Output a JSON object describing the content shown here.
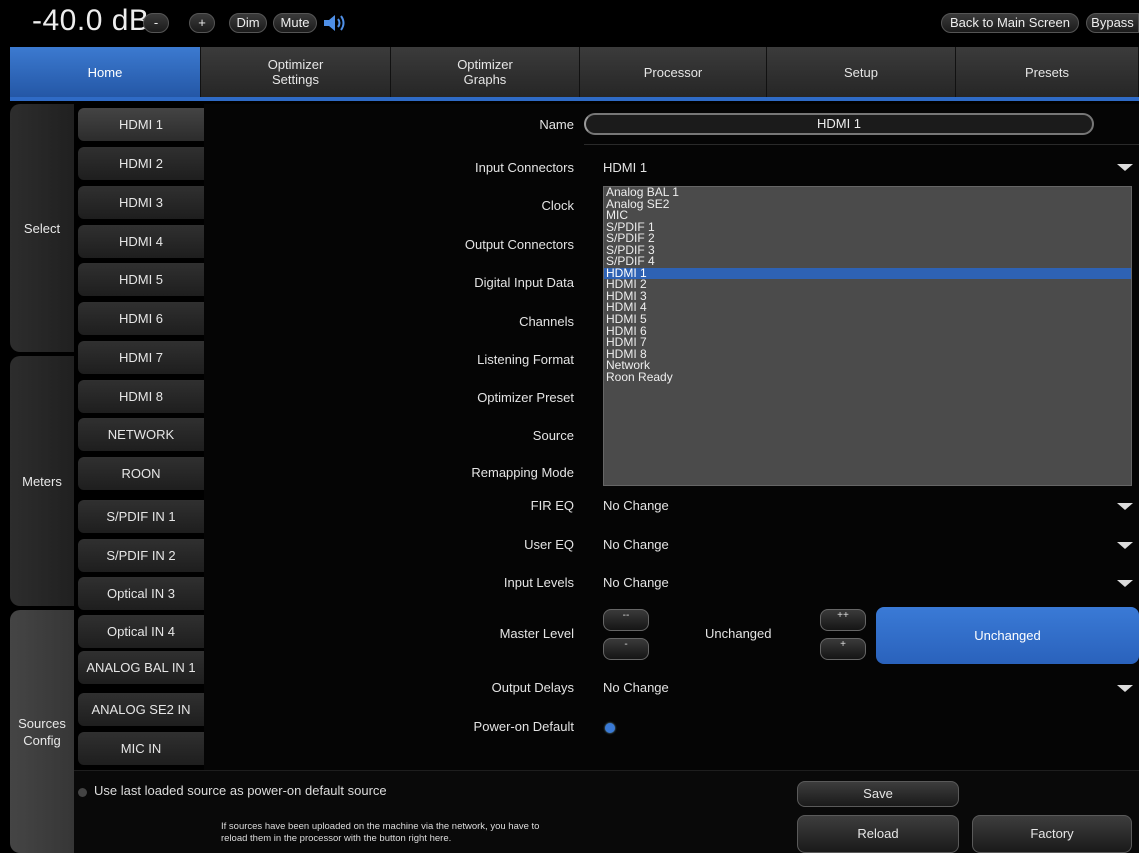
{
  "topbar": {
    "volume": "-40.0 dB",
    "minus": "-",
    "plus": "+",
    "dim": "Dim",
    "mute": "Mute",
    "back": "Back to Main Screen",
    "bypass": "Bypass"
  },
  "tabs": [
    {
      "label": "Home"
    },
    {
      "label": "Optimizer\nSettings"
    },
    {
      "label": "Optimizer\nGraphs"
    },
    {
      "label": "Processor"
    },
    {
      "label": "Setup"
    },
    {
      "label": "Presets"
    }
  ],
  "side": {
    "select": "Select",
    "meters": "Meters",
    "sources": "Sources\nConfig"
  },
  "sources": [
    "HDMI 1",
    "HDMI 2",
    "HDMI 3",
    "HDMI 4",
    "HDMI 5",
    "HDMI 6",
    "HDMI 7",
    "HDMI 8",
    "NETWORK",
    "ROON",
    "S/PDIF IN 1",
    "S/PDIF IN 2",
    "Optical IN 3",
    "Optical IN 4",
    "ANALOG BAL IN 1",
    "ANALOG SE2 IN",
    "MIC IN"
  ],
  "form": {
    "name_label": "Name",
    "name_value": "HDMI 1",
    "input_connectors_label": "Input Connectors",
    "input_connectors_value": "HDMI 1",
    "clock_label": "Clock",
    "output_connectors_label": "Output Connectors",
    "digital_input_label": "Digital Input Data",
    "channels_label": "Channels",
    "listening_format_label": "Listening Format",
    "optimizer_preset_label": "Optimizer Preset",
    "source_label": "Source",
    "remapping_label": "Remapping Mode",
    "fir_label": "FIR EQ",
    "fir_value": "No Change",
    "user_eq_label": "User EQ",
    "user_eq_value": "No Change",
    "input_levels_label": "Input Levels",
    "input_levels_value": "No Change",
    "master_label": "Master Level",
    "master_value": "Unchanged",
    "master_big": "Unchanged",
    "btn_mm": "--",
    "btn_m": "-",
    "btn_pp": "++",
    "btn_p": "+",
    "output_delays_label": "Output Delays",
    "output_delays_value": "No Change",
    "power_on_label": "Power-on Default"
  },
  "dropdown_options": [
    "Analog BAL 1",
    "Analog SE2",
    "MIC",
    "S/PDIF 1",
    "S/PDIF 2",
    "S/PDIF 3",
    "S/PDIF 4",
    "HDMI 1",
    "HDMI 2",
    "HDMI 3",
    "HDMI 4",
    "HDMI 5",
    "HDMI 6",
    "HDMI 7",
    "HDMI 8",
    "Network",
    "Roon Ready"
  ],
  "dropdown_selected": "HDMI 1",
  "bottom": {
    "last_loaded": "Use last loaded source as power-on default source",
    "note_line1": "If sources have been uploaded on the machine via the network, you have to",
    "note_line2": "reload them in the processor with the button right here.",
    "save": "Save",
    "reload": "Reload",
    "factory": "Factory"
  },
  "colors": {
    "accent": "#2f6bc6",
    "highlight": "#2e62b4"
  }
}
